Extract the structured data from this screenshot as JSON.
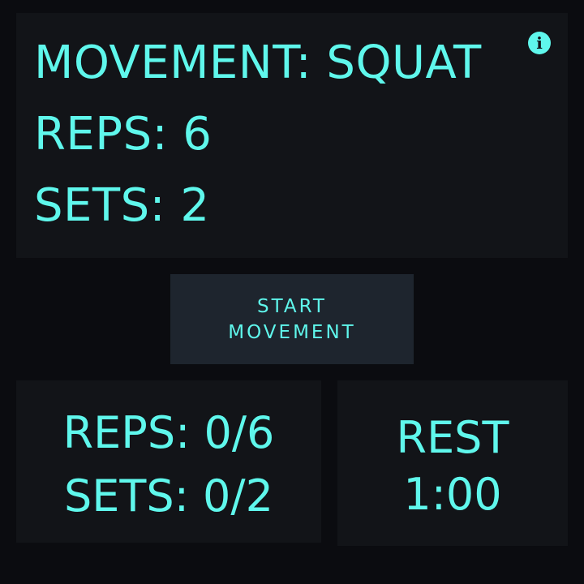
{
  "workout": {
    "movement_text": "MOVEMENT: SQUAT",
    "reps_text": "REPS: 6",
    "sets_text": "SETS: 2"
  },
  "info_button": {
    "icon": "info-icon",
    "glyph": "i"
  },
  "start_button": {
    "line1": "START",
    "line2": "MOVEMENT"
  },
  "progress": {
    "reps_text": "REPS: 0/6",
    "sets_text": "SETS: 0/2"
  },
  "rest": {
    "label": "REST",
    "time": "1:00"
  },
  "colors": {
    "accent": "#5ff7ec",
    "background": "#0b0c10",
    "panel": "#121418",
    "button": "#1e252e"
  }
}
